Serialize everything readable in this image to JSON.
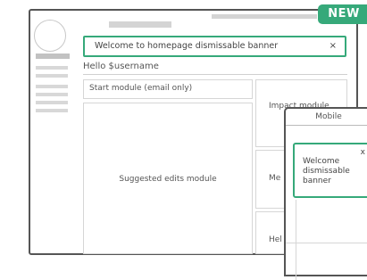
{
  "badge": "NEW",
  "banner": {
    "text": "Welcome to homepage dismissable banner",
    "close": "×"
  },
  "greeting": "Hello $username",
  "modules": {
    "start": "Start module (email only)",
    "suggested": "Suggested edits module",
    "impact": "Impact module",
    "mentor": "Me",
    "help": "Hel"
  },
  "mobile": {
    "title": "Mobile",
    "banner_text": [
      "Welcome",
      "dismissable",
      "banner"
    ],
    "close": "x"
  }
}
